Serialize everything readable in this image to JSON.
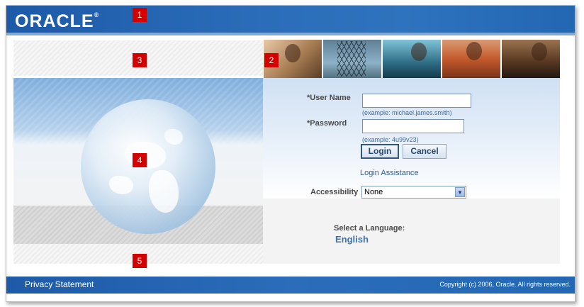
{
  "header": {
    "logo_text": "ORACLE",
    "logo_mark": "®"
  },
  "markers": [
    "1",
    "2",
    "3",
    "4",
    "5"
  ],
  "login": {
    "username_label": "*User Name",
    "username_value": "",
    "username_hint": "(example: michael.james.smith)",
    "password_label": "*Password",
    "password_value": "",
    "password_hint": "(example: 4u99v23)",
    "login_button": "Login",
    "cancel_button": "Cancel",
    "assistance_link": "Login Assistance",
    "accessibility_label": "Accessibility",
    "accessibility_selected": "None"
  },
  "language": {
    "label": "Select a Language:",
    "option": "English"
  },
  "footer": {
    "privacy_link": "Privacy Statement",
    "copyright": "Copyright (c) 2006, Oracle. All rights reserved."
  },
  "colors": {
    "brand_blue": "#2b6db8",
    "marker_red": "#d40000",
    "link_blue": "#2a5d95"
  },
  "icons": {
    "select_arrow": "chevron-down-icon"
  }
}
